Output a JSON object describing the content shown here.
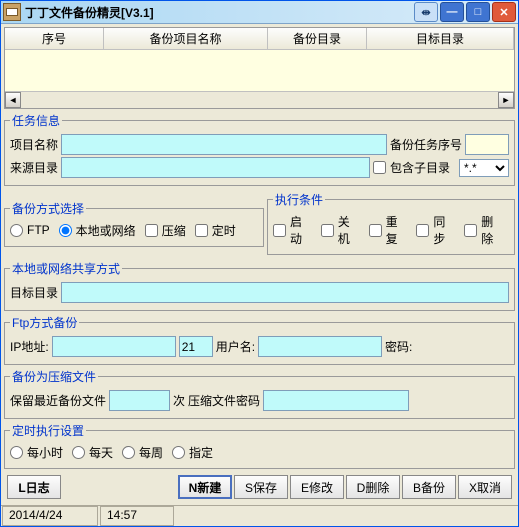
{
  "window": {
    "title": "丁丁文件备份精灵[V3.1]"
  },
  "grid": {
    "headers": [
      "序号",
      "备份项目名称",
      "备份目录",
      "目标目录"
    ]
  },
  "taskInfo": {
    "legend": "任务信息",
    "projectNameLabel": "项目名称",
    "projectName": "",
    "taskNoLabel": "备份任务序号",
    "taskNo": "",
    "sourceDirLabel": "来源目录",
    "sourceDir": "",
    "includeSubLabel": "包含子目录",
    "pattern": "*.*"
  },
  "method": {
    "legend": "备份方式选择",
    "ftp": "FTP",
    "local": "本地或网络",
    "compress": "压缩",
    "timed": "定时"
  },
  "cond": {
    "legend": "执行条件",
    "start": "启动",
    "shutdown": "关机",
    "repeat": "重复",
    "sync": "同步",
    "delete": "删除"
  },
  "localShare": {
    "legend": "本地或网络共享方式",
    "targetDirLabel": "目标目录",
    "targetDir": ""
  },
  "ftp": {
    "legend": "Ftp方式备份",
    "ipLabel": "IP地址:",
    "ip": "",
    "port": "21",
    "userLabel": "用户名:",
    "user": "",
    "pwdLabel": "密码:"
  },
  "zip": {
    "legend": "备份为压缩文件",
    "keepLabel": "保留最近备份文件",
    "count": "",
    "countUnit": "次",
    "zipPwdLabel": "压缩文件密码",
    "zipPwd": ""
  },
  "sched": {
    "legend": "定时执行设置",
    "hourly": "每小时",
    "daily": "每天",
    "weekly": "每周",
    "custom": "指定"
  },
  "buttons": {
    "log": "L日志",
    "new": "N新建",
    "save": "S保存",
    "edit": "E修改",
    "del": "D删除",
    "backup": "B备份",
    "cancel": "X取消"
  },
  "status": {
    "date": "2014/4/24",
    "time": "14:57"
  }
}
